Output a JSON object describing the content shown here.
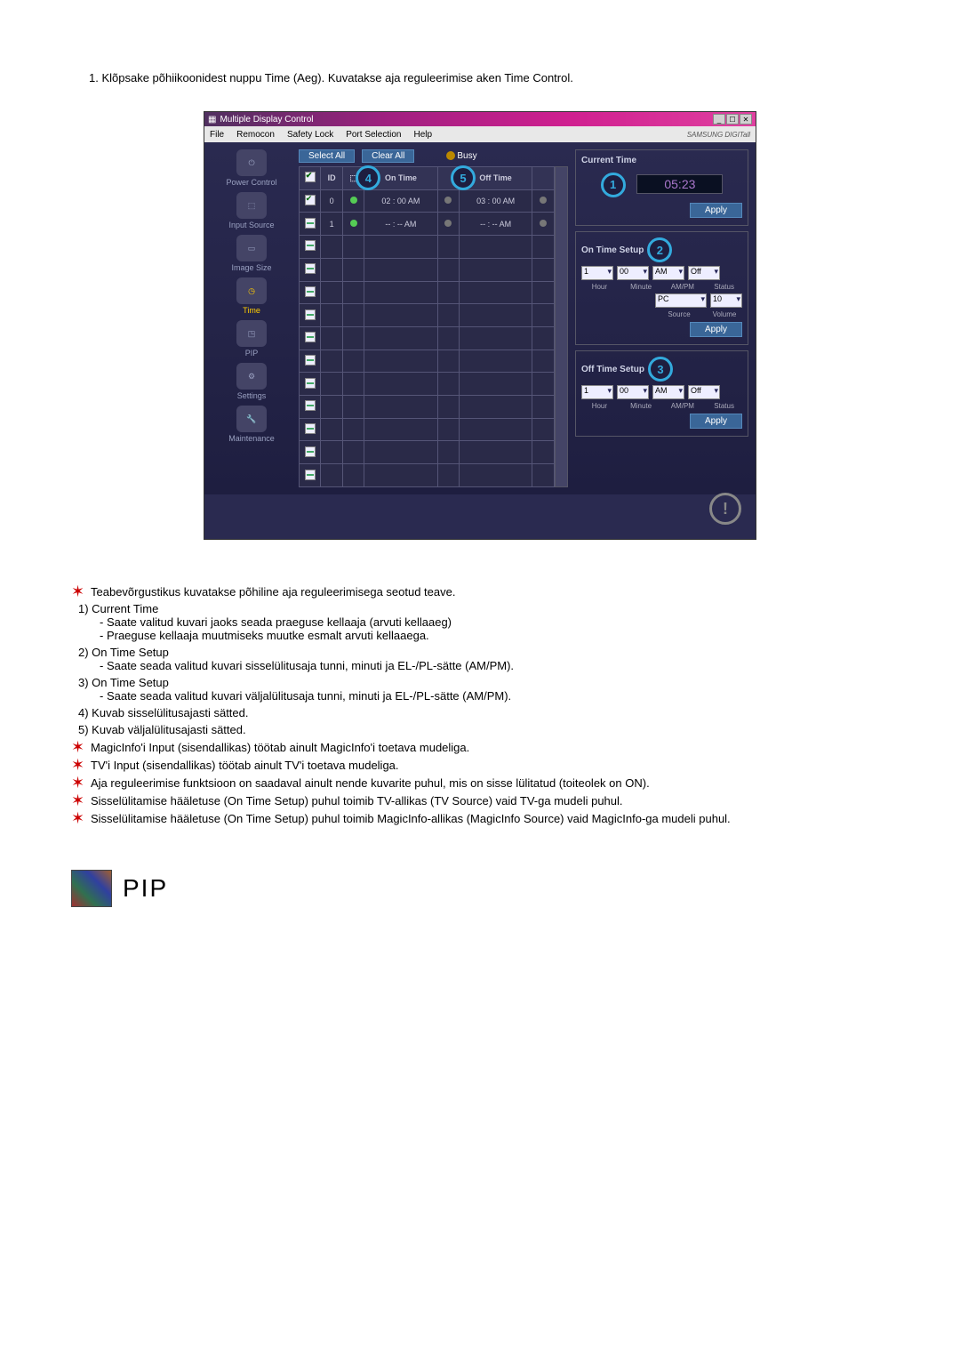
{
  "intro": "1.  Klõpsake põhiikoonidest nuppu Time (Aeg). Kuvatakse aja reguleerimise aken Time Control.",
  "app": {
    "title": "Multiple Display Control",
    "menubar": [
      "File",
      "Remocon",
      "Safety Lock",
      "Port Selection",
      "Help"
    ],
    "brand": "SAMSUNG DIGITall",
    "buttons": {
      "select_all": "Select All",
      "clear_all": "Clear All",
      "busy": "Busy",
      "apply": "Apply"
    }
  },
  "sidebar": {
    "items": [
      {
        "label": "Power Control"
      },
      {
        "label": "Input Source"
      },
      {
        "label": "Image Size"
      },
      {
        "label": "Time"
      },
      {
        "label": "PIP"
      },
      {
        "label": "Settings"
      },
      {
        "label": "Maintenance"
      }
    ]
  },
  "grid": {
    "cols": {
      "checkbox": "☑",
      "id": "ID",
      "icon": "",
      "on_time": "On Time",
      "blank1": "",
      "off_time": "Off Time",
      "blank2": ""
    },
    "badge_on": "4",
    "badge_off": "5",
    "rows": [
      {
        "checked": true,
        "id": "0",
        "on": "green",
        "ontime": "02 : 00 AM",
        "mid": "gray",
        "offtime": "03 : 00 AM",
        "end": "gray"
      },
      {
        "checked": false,
        "id": "1",
        "on": "green",
        "ontime": "-- : -- AM",
        "mid": "gray",
        "offtime": "-- : -- AM",
        "end": "gray"
      }
    ]
  },
  "panels": {
    "current": {
      "title": "Current Time",
      "badge": "1",
      "value": "05:23"
    },
    "on": {
      "title": "On Time Setup",
      "badge": "2",
      "hour": "1",
      "minute": "00",
      "ampm": "AM",
      "status": "Off",
      "labels": [
        "Hour",
        "Minute",
        "AM/PM",
        "Status"
      ],
      "source": "PC",
      "volume": "10",
      "labels2": [
        "Source",
        "Volume"
      ]
    },
    "off": {
      "title": "Off Time Setup",
      "badge": "3",
      "hour": "1",
      "minute": "00",
      "ampm": "AM",
      "status": "Off",
      "labels": [
        "Hour",
        "Minute",
        "AM/PM",
        "Status"
      ]
    }
  },
  "info": {
    "star1": "Teabevõrgustikus kuvatakse põhiline aja reguleerimisega seotud teave.",
    "b1_head": "1)  Current Time",
    "b1_s1": "- Saate valitud kuvari jaoks seada praeguse kellaaja (arvuti kellaaeg)",
    "b1_s2": "- Praeguse kellaaja muutmiseks muutke esmalt arvuti kellaaega.",
    "b2_head": "2)  On Time Setup",
    "b2_s1": "- Saate seada valitud kuvari sisselülitusaja tunni, minuti ja EL-/PL-sätte (AM/PM).",
    "b3_head": "3)  On Time Setup",
    "b3_s1": "- Saate seada valitud kuvari väljalülitusaja tunni, minuti ja EL-/PL-sätte (AM/PM).",
    "b4": "4)  Kuvab sisselülitusajasti sätted.",
    "b5": "5)  Kuvab väljalülitusajasti sätted.",
    "star2": "MagicInfo'i Input (sisendallikas) töötab ainult MagicInfo'i toetava mudeliga.",
    "star3": "TV'i Input (sisendallikas) töötab ainult TV'i toetava mudeliga.",
    "star4": "Aja reguleerimise funktsioon on saadaval ainult nende kuvarite puhul, mis on sisse lülitatud (toiteolek on ON).",
    "star5": "Sisselülitamise hääletuse (On Time Setup) puhul toimib TV-allikas (TV Source) vaid TV-ga mudeli puhul.",
    "star6": "Sisselülitamise hääletuse (On Time Setup) puhul toimib MagicInfo-allikas (MagicInfo Source) vaid MagicInfo-ga mudeli puhul."
  },
  "pip": {
    "heading": "PIP"
  }
}
